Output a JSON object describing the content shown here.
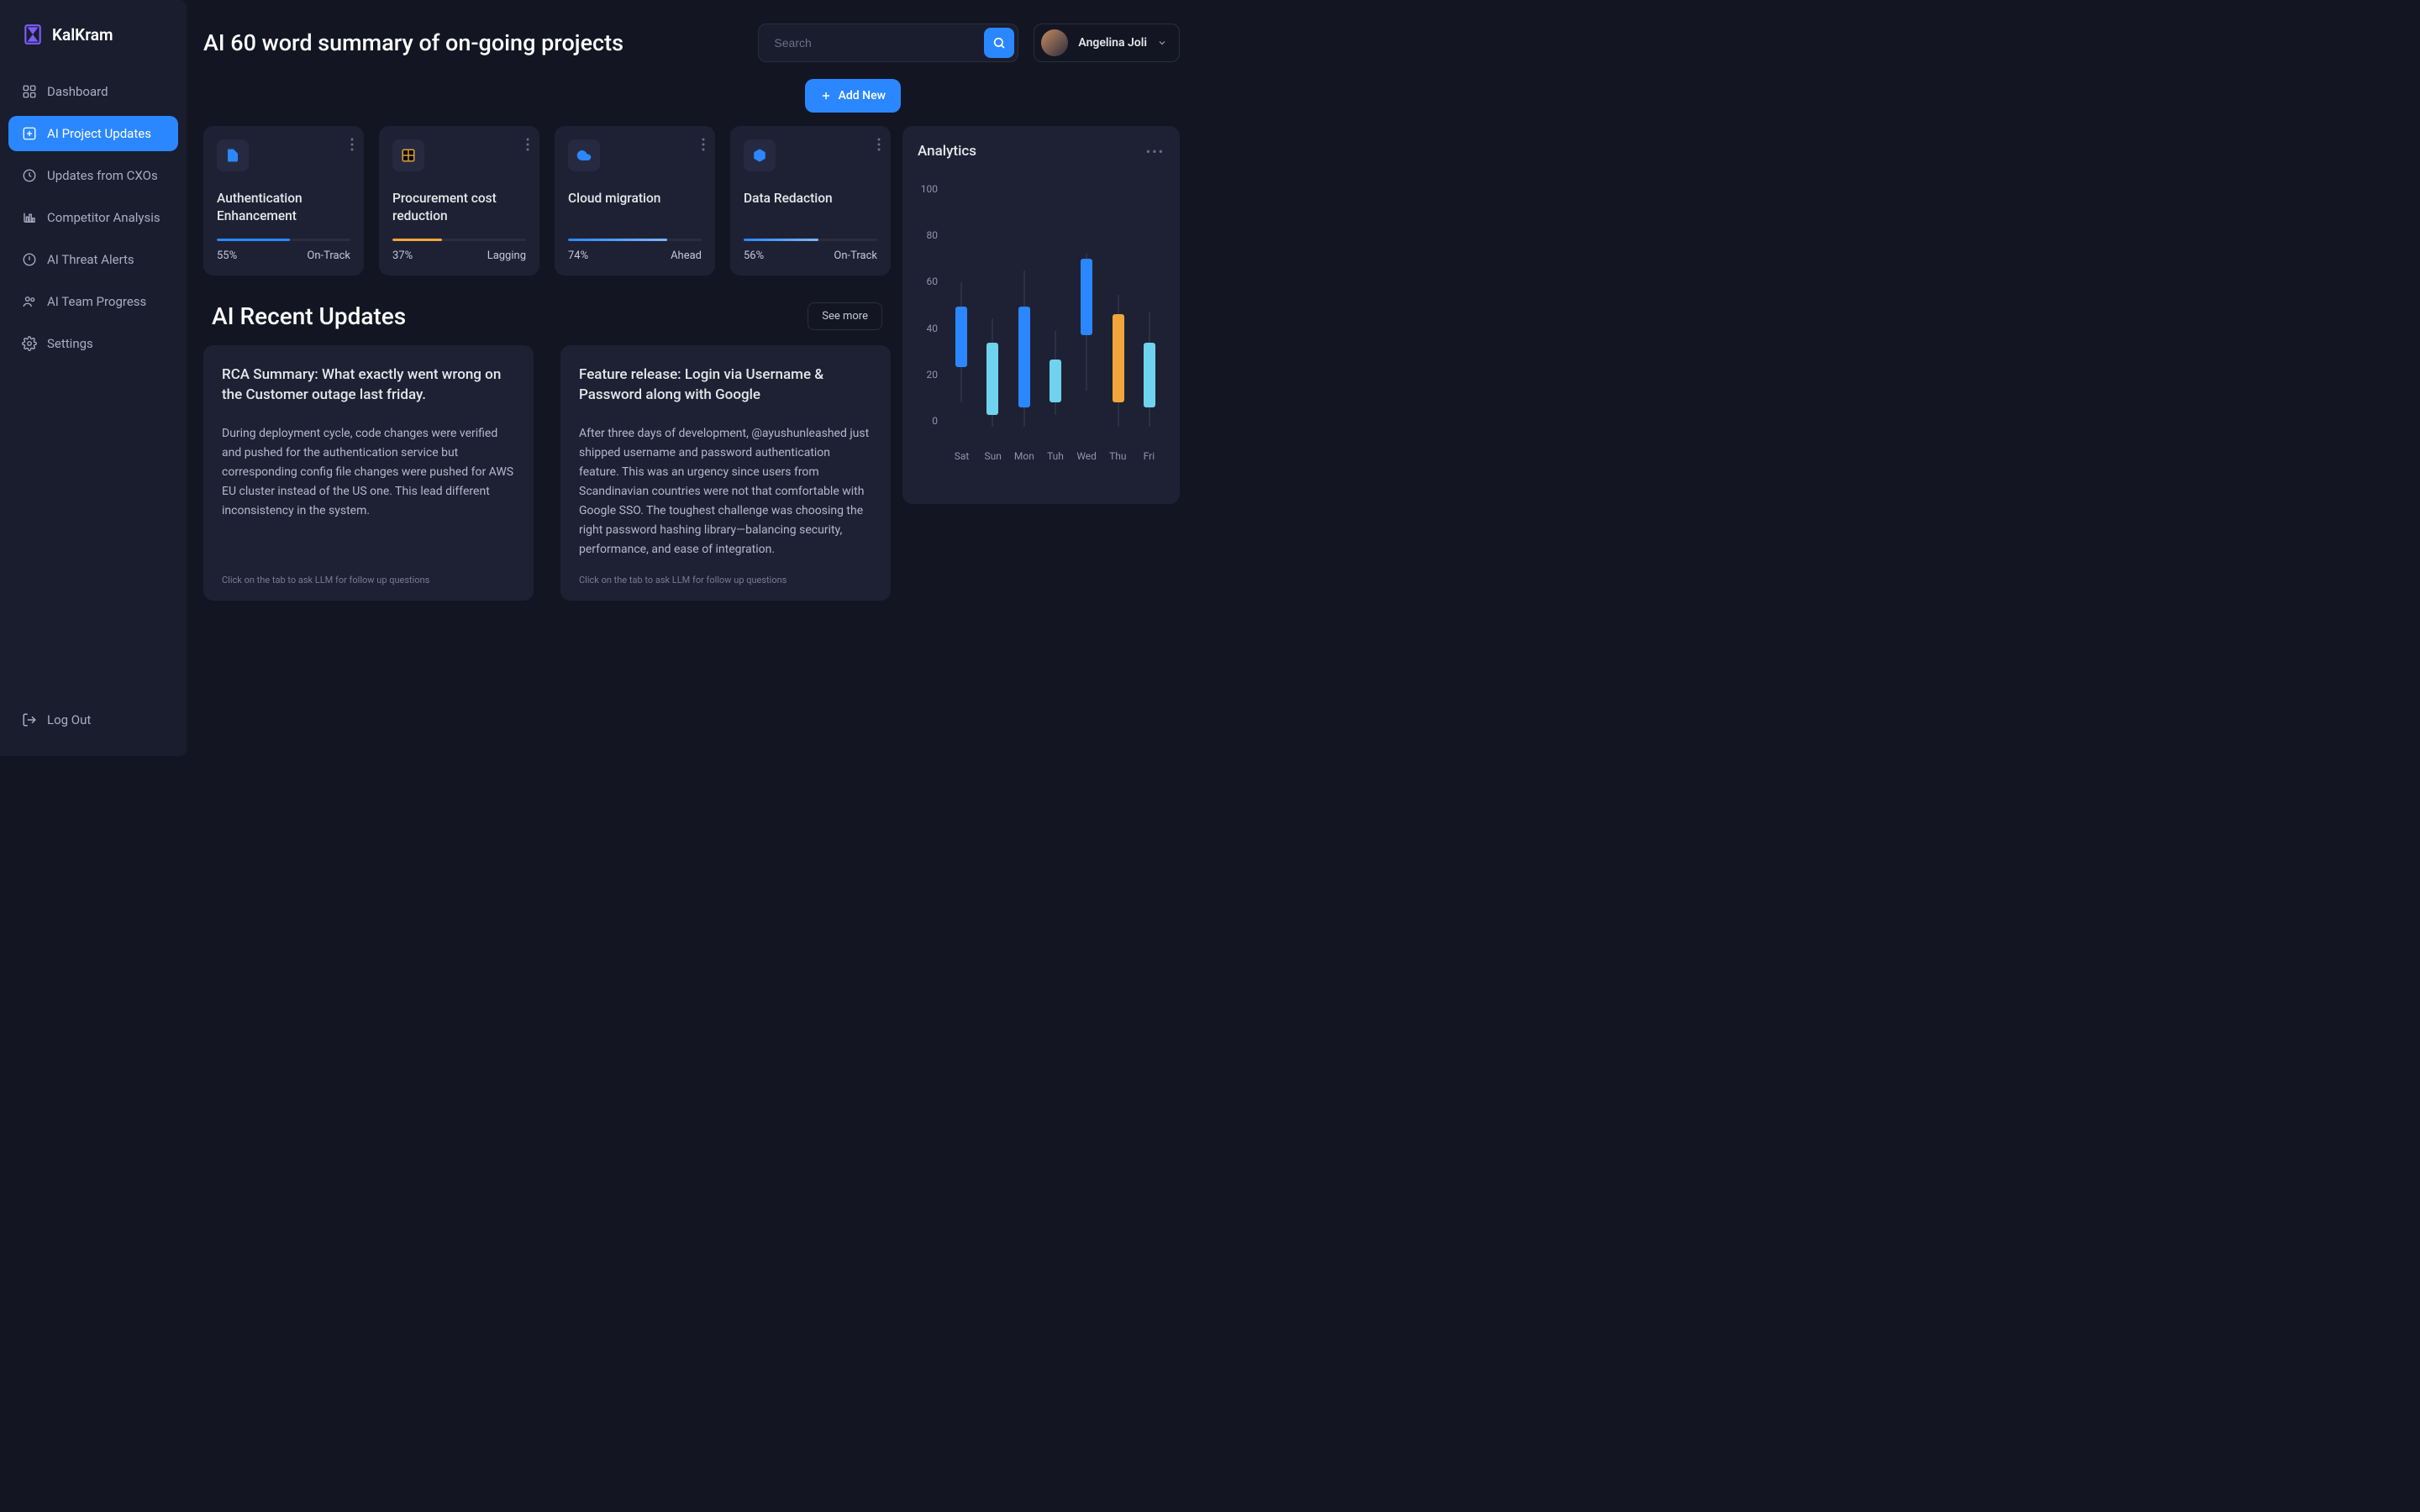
{
  "brand": "KalKram",
  "sidebar": {
    "items": [
      {
        "icon": "dashboard",
        "label": "Dashboard",
        "active": false
      },
      {
        "icon": "ai-updates",
        "label": "AI Project Updates",
        "active": true
      },
      {
        "icon": "clock",
        "label": "Updates from CXOs",
        "active": false
      },
      {
        "icon": "chart",
        "label": "Competitor Analysis",
        "active": false
      },
      {
        "icon": "alert",
        "label": "AI Threat Alerts",
        "active": false
      },
      {
        "icon": "team",
        "label": "AI Team Progress",
        "active": false
      },
      {
        "icon": "settings",
        "label": "Settings",
        "active": false
      }
    ],
    "logout": "Log Out"
  },
  "header": {
    "title": "AI 60 word summary of on-going projects",
    "search_placeholder": "Search",
    "user_name": "Angelina Joli"
  },
  "add_button": "Add New",
  "projects": [
    {
      "icon": "file",
      "icon_color": "#2b87ff",
      "title": "Authentication Enhancement",
      "percent": "55%",
      "status": "On-Track",
      "fill": 55,
      "bar_color": "#2b87ff"
    },
    {
      "icon": "grid",
      "icon_color": "#e0a030",
      "title": "Procurement cost reduction",
      "percent": "37%",
      "status": "Lagging",
      "fill": 37,
      "bar_color": "#f0a63a"
    },
    {
      "icon": "cloud",
      "icon_color": "#2b87ff",
      "title": "Cloud migration",
      "percent": "74%",
      "status": "Ahead",
      "fill": 74,
      "bar_color": "linear-gradient(90deg,#2b87ff,#7fb4ff)"
    },
    {
      "icon": "box",
      "icon_color": "#2b87ff",
      "title": "Data Redaction",
      "percent": "56%",
      "status": "On-Track",
      "fill": 56,
      "bar_color": "linear-gradient(90deg,#2b87ff,#7fb4ff)"
    }
  ],
  "recent": {
    "title": "AI Recent Updates",
    "see_more": "See more",
    "cards": [
      {
        "title": "RCA Summary: What exactly went wrong on the Customer outage last friday.",
        "body": "During deployment cycle, code changes were verified and pushed for the authentication service but corresponding config file changes were pushed for AWS EU cluster instead of the US one. This lead different inconsistency in the system.",
        "hint": "Click on the tab to ask LLM for follow up questions"
      },
      {
        "title": "Feature release: Login via  Username & Password along with Google",
        "body": "After three days of development, @ayushunleashed just shipped username and password authentication feature.  This was an urgency since users from Scandinavian countries were not that comfortable with Google SSO. The toughest challenge was choosing the right password hashing library—balancing security, performance, and ease of integration.",
        "hint": "Click on the tab to ask LLM for follow up questions"
      }
    ]
  },
  "analytics": {
    "title": "Analytics"
  },
  "chart_data": {
    "type": "candlestick",
    "ylim": [
      0,
      100
    ],
    "y_ticks": [
      100,
      80,
      60,
      40,
      20,
      0
    ],
    "categories": [
      "Sat",
      "Sun",
      "Mon",
      "Tuh",
      "Wed",
      "Thu",
      "Fri"
    ],
    "series": [
      {
        "day": "Sat",
        "whisker_low": 10,
        "whisker_high": 60,
        "box_low": 25,
        "box_high": 50,
        "color": "#2b87ff"
      },
      {
        "day": "Sun",
        "whisker_low": 0,
        "whisker_high": 45,
        "box_low": 5,
        "box_high": 35,
        "color": "#6fd3ef"
      },
      {
        "day": "Mon",
        "whisker_low": 0,
        "whisker_high": 65,
        "box_low": 8,
        "box_high": 50,
        "color": "#2b87ff"
      },
      {
        "day": "Tuh",
        "whisker_low": 5,
        "whisker_high": 40,
        "box_low": 10,
        "box_high": 28,
        "color": "#6fd3ef"
      },
      {
        "day": "Wed",
        "whisker_low": 15,
        "whisker_high": 72,
        "box_low": 38,
        "box_high": 70,
        "color": "#2b87ff"
      },
      {
        "day": "Thu",
        "whisker_low": 0,
        "whisker_high": 55,
        "box_low": 10,
        "box_high": 47,
        "color": "#f0a63a"
      },
      {
        "day": "Fri",
        "whisker_low": 0,
        "whisker_high": 48,
        "box_low": 8,
        "box_high": 35,
        "color": "#6fd3ef"
      }
    ]
  }
}
